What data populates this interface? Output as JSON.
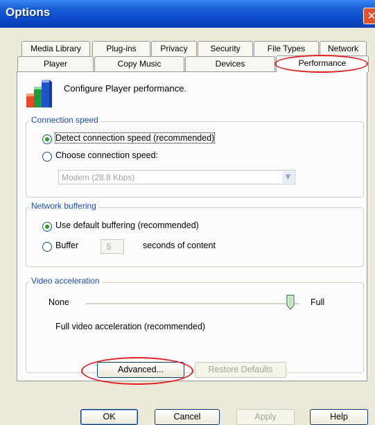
{
  "window": {
    "title": "Options",
    "close_glyph": "✕"
  },
  "tabs": {
    "row1": [
      "Media Library",
      "Plug-ins",
      "Privacy",
      "Security",
      "File Types",
      "Network"
    ],
    "row2": [
      "Player",
      "Copy Music",
      "Devices",
      "Performance"
    ],
    "active": "Performance"
  },
  "header": {
    "text": "Configure Player performance.",
    "icon": "performance-icon"
  },
  "connection_speed": {
    "title": "Connection speed",
    "detect_label": "Detect connection speed (recommended)",
    "choose_label": "Choose connection speed:",
    "selected": "detect",
    "dropdown_value": "Modem (28.8 Kbps)"
  },
  "network_buffering": {
    "title": "Network buffering",
    "default_label": "Use default buffering (recommended)",
    "buffer_label": "Buffer",
    "buffer_value": "5",
    "buffer_suffix": "seconds of content",
    "selected": "default"
  },
  "video_acceleration": {
    "title": "Video acceleration",
    "min_label": "None",
    "max_label": "Full",
    "level": 1.0,
    "status": "Full video acceleration (recommended)"
  },
  "buttons": {
    "advanced": "Advanced...",
    "restore_defaults": "Restore Defaults",
    "ok": "OK",
    "cancel": "Cancel",
    "apply": "Apply",
    "help": "Help"
  },
  "colors": {
    "titlebar": "#0b4ac7",
    "highlight_ellipse": "#e02020",
    "group_title": "#1d4bb0"
  }
}
